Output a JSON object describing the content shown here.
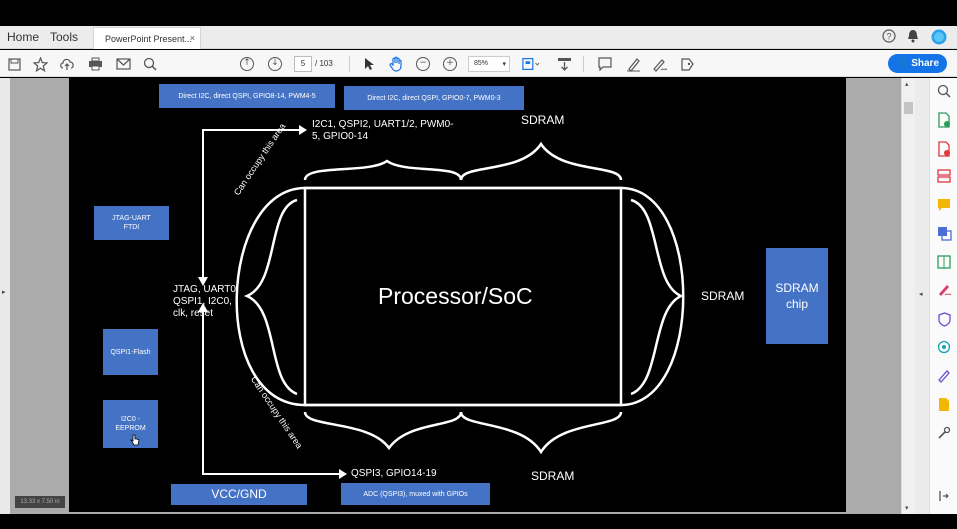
{
  "menu": {
    "home": "Home",
    "tools": "Tools"
  },
  "tab": {
    "title": "PowerPoint Present...",
    "close": "×"
  },
  "toolbar": {
    "page_current": "5",
    "page_total": "/ 103",
    "zoom": "85%",
    "share": "Share"
  },
  "slide": {
    "top_box_left": "Direct I2C, direct QSPI, GPIO8-14, PWM4-5",
    "top_box_right": "Direct I2C, direct QSPI, GPIO0-7, PWM0-3",
    "top_label_line1": "I2C1, QSPI2, UART1/2, PWM0-",
    "top_label_line2": "5, GPIO0-14",
    "sdram_top": "SDRAM",
    "sdram_right": "SDRAM",
    "sdram_bottom": "SDRAM",
    "jtag_uart_line1": "JTAG-UART",
    "jtag_uart_line2": "FTDI",
    "left_label_line1": "JTAG, UART0",
    "left_label_line2": "QSPI1, I2C0,",
    "left_label_line3": "clk, reset",
    "qspi_flash": "QSPI1-Flash",
    "eeprom_line1": "I2C0 -",
    "eeprom_line2": "EEPROM",
    "processor": "Processor/SoC",
    "occupy_top": "Can occupy this area",
    "occupy_bottom": "Can occupy this area",
    "bottom_label": "QSPI3, GPIO14-19",
    "vcc_gnd": "VCC/GND",
    "adc_box": "ADC (QSPI3), muxed with GPIOs",
    "sdram_chip_line1": "SDRAM",
    "sdram_chip_line2": "chip"
  },
  "status": {
    "dims": "13.33 x 7.50 in"
  },
  "colors": {
    "accent": "#1473e6",
    "slide_box": "#4472c4"
  }
}
